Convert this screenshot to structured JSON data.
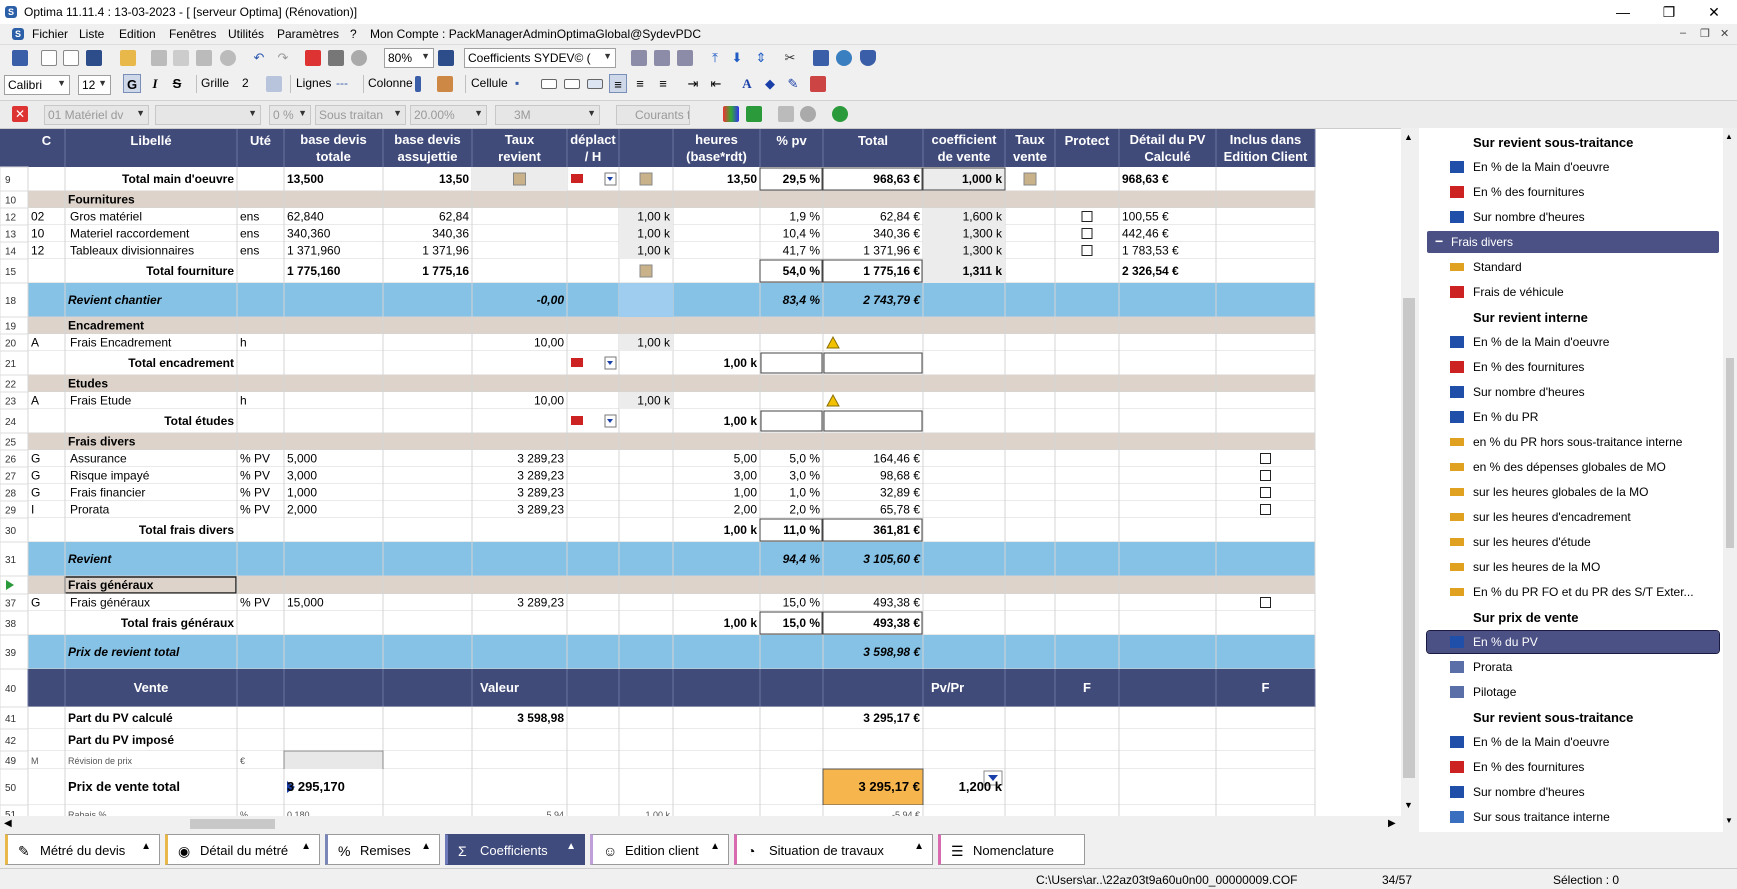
{
  "title": "Optima 11.11.4 : 13-03-2023 - [ [serveur Optima] (Rénovation)]",
  "menu": [
    "Fichier",
    "Liste",
    "Edition",
    "Fenêtres",
    "Utilités",
    "Paramètres",
    "?",
    "Mon Compte : PackManagerAdminOptimaGlobal@SydevPDC"
  ],
  "toolbar": {
    "zoom": "80%",
    "coef_combo": "Coefficients  SYDEV© (",
    "font": "Calibri",
    "size": "12",
    "grille_label": "Grille",
    "grille_val": "2",
    "lignes": "Lignes",
    "colonne": "Colonne",
    "cellule": "Cellule",
    "bold": "G",
    "italic": "I",
    "strike": "S"
  },
  "filterbar": {
    "f1": "01  Matériel dv",
    "f2": "",
    "f3": "0 %",
    "f4": "Sous traitan",
    "f5": "20.00%",
    "f6": "3M",
    "f7": "Courants f"
  },
  "grid": {
    "headers": [
      "C",
      "Libellé",
      "Uté",
      "base devis\ntotale",
      "base devis\nassujettie",
      "Taux\nrevient",
      "déplact\n/ H",
      "",
      "heures\n(base*rdt)",
      "% pv",
      "Total",
      "coefficient\nde vente",
      "Taux\nvente",
      "Protect",
      "Détail du PV\nCalculé",
      "Inclus dans\nEdition Client"
    ],
    "rows": [
      {
        "n": "9",
        "t": "total",
        "c": [
          "",
          "Total main d'oeuvre",
          "",
          "13,500",
          "13,50",
          "ic",
          "car",
          "ic",
          "13,50",
          "29,5 %",
          "968,63 €",
          "1,000 k",
          "ic",
          "",
          "968,63 €",
          ""
        ]
      },
      {
        "n": "10",
        "t": "sect",
        "c": [
          "",
          "Fournitures"
        ]
      },
      {
        "n": "12",
        "t": "line",
        "c": [
          "02",
          "Gros matériel",
          "ens",
          "62,840",
          "62,84",
          "",
          "",
          "1,00 k",
          "",
          "1,9 %",
          "62,84 €",
          "1,600 k",
          "",
          "cb",
          "100,55 €",
          ""
        ]
      },
      {
        "n": "13",
        "t": "line",
        "c": [
          "10",
          "Materiel raccordement",
          "ens",
          "340,360",
          "340,36",
          "",
          "",
          "1,00 k",
          "",
          "10,4 %",
          "340,36 €",
          "1,300 k",
          "",
          "cb",
          "442,46 €",
          ""
        ]
      },
      {
        "n": "14",
        "t": "line",
        "c": [
          "12",
          "Tableaux divisionnaires",
          "ens",
          "1 371,960",
          "1 371,96",
          "",
          "",
          "1,00 k",
          "",
          "41,7 %",
          "1 371,96 €",
          "1,300 k",
          "",
          "cb",
          "1 783,53 €",
          ""
        ]
      },
      {
        "n": "15",
        "t": "total",
        "c": [
          "",
          "Total fourniture",
          "",
          "1 775,160",
          "1 775,16",
          "",
          "",
          "ic",
          "",
          "54,0 %",
          "1 775,16 €",
          "1,311 k",
          "",
          "",
          "2 326,54 €",
          ""
        ]
      },
      {
        "n": "18",
        "t": "blue",
        "c": [
          "",
          "Revient chantier",
          "",
          "",
          "",
          "-0,00",
          "",
          "",
          "",
          "83,4 %",
          "2 743,79 €",
          "",
          "",
          "",
          "",
          ""
        ]
      },
      {
        "n": "19",
        "t": "sect",
        "c": [
          "",
          "Encadrement"
        ]
      },
      {
        "n": "20",
        "t": "line",
        "c": [
          "A",
          "Frais Encadrement",
          "h",
          "",
          "",
          "10,00",
          "",
          "1,00 k",
          "",
          "",
          "warn",
          "",
          "",
          "",
          "",
          ""
        ]
      },
      {
        "n": "21",
        "t": "total",
        "c": [
          "",
          "Total encadrement",
          "",
          "",
          "",
          "",
          "car",
          "",
          "1,00 k",
          "box",
          "box",
          "",
          "",
          "",
          "",
          ""
        ]
      },
      {
        "n": "22",
        "t": "sect",
        "c": [
          "",
          "Etudes"
        ]
      },
      {
        "n": "23",
        "t": "line",
        "c": [
          "A",
          "Frais Etude",
          "h",
          "",
          "",
          "10,00",
          "",
          "1,00 k",
          "",
          "",
          "warn",
          "",
          "",
          "",
          "",
          ""
        ]
      },
      {
        "n": "24",
        "t": "total",
        "c": [
          "",
          "Total études",
          "",
          "",
          "",
          "",
          "car",
          "",
          "1,00 k",
          "box",
          "box",
          "",
          "",
          "",
          "",
          ""
        ]
      },
      {
        "n": "25",
        "t": "sect",
        "c": [
          "",
          "Frais divers"
        ]
      },
      {
        "n": "26",
        "t": "line",
        "c": [
          "G",
          "Assurance",
          "% PV",
          "5,000",
          "",
          "3 289,23",
          "",
          "",
          "5,00",
          "5,0 %",
          "164,46 €",
          "",
          "",
          "",
          "",
          "cb"
        ]
      },
      {
        "n": "27",
        "t": "line",
        "c": [
          "G",
          "Risque impayé",
          "% PV",
          "3,000",
          "",
          "3 289,23",
          "",
          "",
          "3,00",
          "3,0 %",
          "98,68 €",
          "",
          "",
          "",
          "",
          "cb"
        ]
      },
      {
        "n": "28",
        "t": "line",
        "c": [
          "G",
          "Frais financier",
          "% PV",
          "1,000",
          "",
          "3 289,23",
          "",
          "",
          "1,00",
          "1,0 %",
          "32,89 €",
          "",
          "",
          "",
          "",
          "cb"
        ]
      },
      {
        "n": "29",
        "t": "line",
        "c": [
          "I",
          "Prorata",
          "% PV",
          "2,000",
          "",
          "3 289,23",
          "",
          "",
          "2,00",
          "2,0 %",
          "65,78 €",
          "",
          "",
          "",
          "",
          "cb"
        ]
      },
      {
        "n": "30",
        "t": "total",
        "c": [
          "",
          "Total frais divers",
          "",
          "",
          "",
          "",
          "",
          "",
          "1,00 k",
          "11,0 %",
          "361,81 €",
          "",
          "",
          "",
          "",
          ""
        ]
      },
      {
        "n": "31",
        "t": "blue",
        "c": [
          "",
          "Revient",
          "",
          "",
          "",
          "",
          "",
          "",
          "",
          "94,4 %",
          "3 105,60 €",
          "",
          "",
          "",
          "",
          ""
        ]
      },
      {
        "n": "",
        "t": "sectsel",
        "c": [
          "",
          "Frais généraux"
        ]
      },
      {
        "n": "37",
        "t": "line",
        "c": [
          "G",
          "Frais généraux",
          "% PV",
          "15,000",
          "",
          "3 289,23",
          "",
          "",
          "",
          "15,0 %",
          "493,38 €",
          "",
          "",
          "",
          "",
          "cb"
        ]
      },
      {
        "n": "38",
        "t": "total",
        "c": [
          "",
          "Total frais généraux",
          "",
          "",
          "",
          "",
          "",
          "",
          "1,00 k",
          "15,0 %",
          "493,38 €",
          "",
          "",
          "",
          "",
          ""
        ]
      },
      {
        "n": "39",
        "t": "blue",
        "c": [
          "",
          "Prix de revient total",
          "",
          "",
          "",
          "",
          "",
          "",
          "",
          "",
          "3 598,98 €",
          "",
          "",
          "",
          "",
          ""
        ]
      },
      {
        "n": "40",
        "t": "navy",
        "c": [
          "",
          "Vente",
          "",
          "",
          "",
          "Valeur",
          "",
          "",
          "",
          "",
          "",
          "Pv/Pr",
          "",
          "F",
          "",
          "F"
        ]
      },
      {
        "n": "41",
        "t": "pv",
        "c": [
          "",
          "Part du PV calculé",
          "",
          "",
          "",
          "3 598,98",
          "",
          "",
          "",
          "",
          "3 295,17 €",
          "",
          "",
          "",
          "",
          ""
        ]
      },
      {
        "n": "42",
        "t": "pv",
        "c": [
          "",
          "Part du PV imposé",
          "",
          "",
          "",
          "",
          "",
          "",
          "",
          "",
          "",
          "",
          "",
          "",
          "",
          ""
        ]
      },
      {
        "n": "49",
        "t": "small",
        "c": [
          "M",
          "Révision de prix",
          "€",
          "",
          "",
          "",
          "",
          "",
          "",
          "",
          "",
          "",
          "",
          "",
          "",
          ""
        ]
      },
      {
        "n": "50",
        "t": "pvt",
        "c": [
          "",
          "Prix de vente total",
          "",
          "3 295,170",
          "",
          "",
          "",
          "",
          "",
          "",
          "3 295,17 €",
          "1,200 k",
          "",
          "",
          "",
          ""
        ]
      },
      {
        "n": "51",
        "t": "small",
        "c": [
          "",
          "Rabais %",
          "%",
          "0,180",
          "",
          "5,94",
          "",
          "1,00 k",
          "",
          "",
          "-5,94 €",
          "",
          "",
          "",
          "",
          ""
        ]
      }
    ]
  },
  "panel": [
    {
      "k": "hdr",
      "l": "Sur revient sous-traitance"
    },
    {
      "k": "item",
      "l": "En % de la Main d'oeuvre",
      "i": "mo"
    },
    {
      "k": "item",
      "l": "En % des fournitures",
      "i": "fo"
    },
    {
      "k": "item",
      "l": "Sur nombre d'heures",
      "i": "mo"
    },
    {
      "k": "grp",
      "l": "Frais divers"
    },
    {
      "k": "item",
      "l": "Standard",
      "i": "std"
    },
    {
      "k": "item",
      "l": "Frais de véhicule",
      "i": "car"
    },
    {
      "k": "hdr",
      "l": "Sur revient interne"
    },
    {
      "k": "item",
      "l": "En % de la Main d'oeuvre",
      "i": "mo"
    },
    {
      "k": "item",
      "l": "En % des fournitures",
      "i": "fo"
    },
    {
      "k": "item",
      "l": "Sur nombre d'heures",
      "i": "mo"
    },
    {
      "k": "item",
      "l": "En % du PR",
      "i": "mo"
    },
    {
      "k": "item",
      "l": "en % du PR hors sous-traitance interne",
      "i": "std"
    },
    {
      "k": "item",
      "l": "en % des dépenses globales de MO",
      "i": "std"
    },
    {
      "k": "item",
      "l": "sur les heures globales de la MO",
      "i": "std"
    },
    {
      "k": "item",
      "l": "sur les heures d'encadrement",
      "i": "std"
    },
    {
      "k": "item",
      "l": "sur les heures d'étude",
      "i": "std"
    },
    {
      "k": "item",
      "l": "sur les heures de la MO",
      "i": "std"
    },
    {
      "k": "item",
      "l": "En % du PR FO et du PR des S/T Exter...",
      "i": "std"
    },
    {
      "k": "hdr",
      "l": "Sur prix de vente"
    },
    {
      "k": "sel",
      "l": "En % du PV",
      "i": "mo"
    },
    {
      "k": "item",
      "l": "Prorata",
      "i": "pv"
    },
    {
      "k": "item",
      "l": "Pilotage",
      "i": "pv"
    },
    {
      "k": "hdr",
      "l": "Sur revient sous-traitance"
    },
    {
      "k": "item",
      "l": "En % de la Main d'oeuvre",
      "i": "mo"
    },
    {
      "k": "item",
      "l": "En % des fournitures",
      "i": "fo"
    },
    {
      "k": "item",
      "l": "Sur nombre d'heures",
      "i": "mo"
    },
    {
      "k": "item",
      "l": "Sur sous traitance interne",
      "i": "grp"
    }
  ],
  "tabs": [
    {
      "l": "Métré du devis",
      "i": "✎"
    },
    {
      "l": "Détail du métré",
      "i": "◉"
    },
    {
      "l": "Remises",
      "i": "%"
    },
    {
      "l": "Coefficients",
      "i": "Σ"
    },
    {
      "l": "Edition client",
      "i": "☺"
    },
    {
      "l": "Situation de travaux",
      "i": "◔"
    },
    {
      "l": "Nomenclature",
      "i": "☰"
    }
  ],
  "status": {
    "path": "C:\\Users\\ar..\\22az03t9a60u0n00_00000009.COF",
    "pos": "34/57",
    "sel": "Sélection : 0"
  }
}
